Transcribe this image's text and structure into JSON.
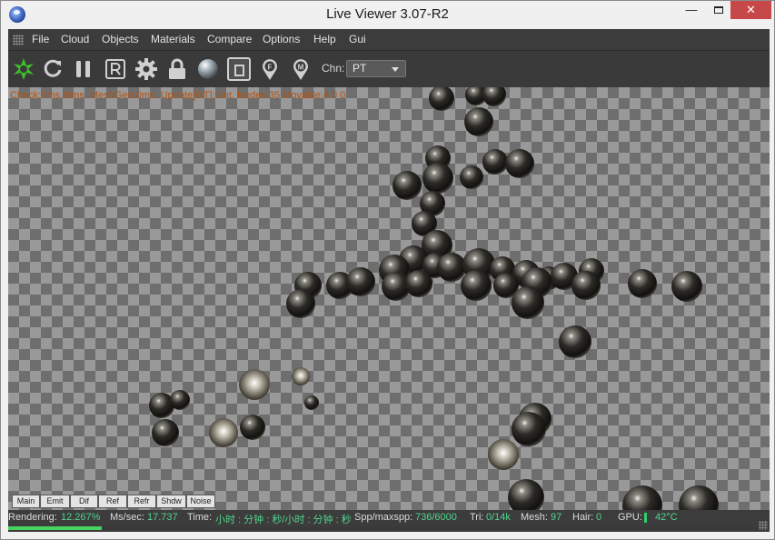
{
  "window": {
    "title": "Live Viewer 3.07-R2",
    "minimize_glyph": "—",
    "close_glyph": "✕"
  },
  "menubar": {
    "items": [
      "File",
      "Cloud",
      "Objects",
      "Materials",
      "Compare",
      "Options",
      "Help",
      "Gui"
    ]
  },
  "toolbar": {
    "buttons": [
      "octane-logo-icon",
      "refresh-icon",
      "pause-icon",
      "region-render-icon",
      "settings-gear-icon",
      "lock-icon",
      "material-ball-icon",
      "focus-picker-icon",
      "focus-pin-icon",
      "material-pin-icon"
    ],
    "channel_label": "Chn:",
    "channel_value": "PT"
  },
  "viewport": {
    "stats_line": "Check:0ms./8ms. MeshGen:0ms. Update[GT]:0mt. Nodes:35 Movable:4 0 0"
  },
  "pass_tabs": [
    "Main",
    "Emit",
    "Dif",
    "Ref",
    "Refr",
    "Shdw",
    "Noise"
  ],
  "status": {
    "rendering_label": "Rendering:",
    "rendering_value": "12.267%",
    "mssec_label": "Ms/sec:",
    "mssec_value": "17.737",
    "time_label": "Time:",
    "time_value": "小时 : 分钟 : 秒/小时 : 分钟 : 秒",
    "spp_label": "Spp/maxspp:",
    "spp_value": "736/6000",
    "tri_label": "Tri:",
    "tri_value": "0/14k",
    "mesh_label": "Mesh:",
    "mesh_value": "97",
    "hair_label": "Hair:",
    "hair_value": "0",
    "gpu_label": "GPU:",
    "gpu_temp": "42°C",
    "progress_fraction": 0.12267
  },
  "colors": {
    "accent_green": "#52d48e",
    "stats_orange": "#b5520e",
    "panel_dark": "#3c3c3c"
  }
}
